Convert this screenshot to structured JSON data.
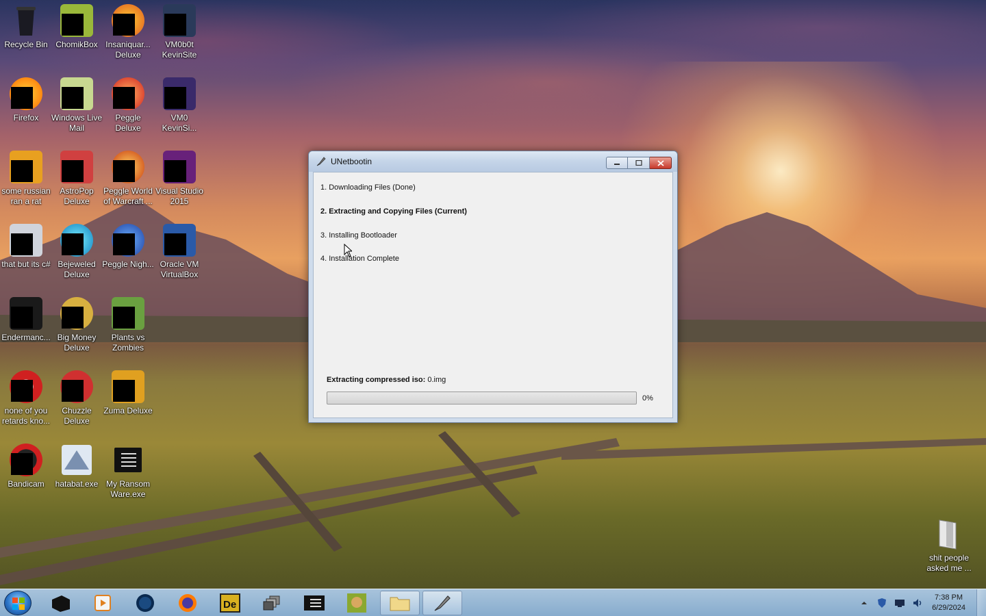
{
  "desktop": {
    "icons": [
      {
        "label": "Recycle Bin"
      },
      {
        "label": "ChomikBox"
      },
      {
        "label": "Insaniquar... Deluxe"
      },
      {
        "label": "VM0b0t KevinSite"
      },
      {
        "label": "Firefox"
      },
      {
        "label": "Windows Live Mail"
      },
      {
        "label": "Peggle Deluxe"
      },
      {
        "label": "VM0 KevinSi..."
      },
      {
        "label": "some russian ran a rat"
      },
      {
        "label": "AstroPop Deluxe"
      },
      {
        "label": "Peggle World of Warcraft ..."
      },
      {
        "label": "Visual Studio 2015"
      },
      {
        "label": "that but its c#"
      },
      {
        "label": "Bejeweled Deluxe"
      },
      {
        "label": "Peggle Nigh..."
      },
      {
        "label": "Oracle VM VirtualBox"
      },
      {
        "label": "Endermanc..."
      },
      {
        "label": "Big Money Deluxe"
      },
      {
        "label": "Plants vs Zombies"
      },
      {
        "label": "none of you retards kno..."
      },
      {
        "label": "Chuzzle Deluxe"
      },
      {
        "label": "Zuma Deluxe"
      },
      {
        "label": "Bandicam"
      },
      {
        "label": "hatabat.exe"
      },
      {
        "label": "My Ransom Ware.exe"
      },
      {
        "label": "shit people asked me ..."
      }
    ]
  },
  "window": {
    "title": "UNetbootin",
    "steps": [
      "1. Downloading Files (Done)",
      "2. Extracting and Copying Files (Current)",
      "3. Installing Bootloader",
      "4. Installation Complete"
    ],
    "status_label": "Extracting compressed iso:",
    "status_value": "0.img",
    "progress_fraction": 0.0,
    "progress_text": "0%"
  },
  "taskbar": {
    "items": [
      "Start",
      "Terminal",
      "Media Player",
      "Browser",
      "Firefox",
      "Dreamweaver",
      "Windows",
      "Console",
      "ChomikBox",
      "Explorer",
      "UNetbootin"
    ],
    "clock_time": "7:38 PM",
    "clock_date": "6/29/2024"
  }
}
